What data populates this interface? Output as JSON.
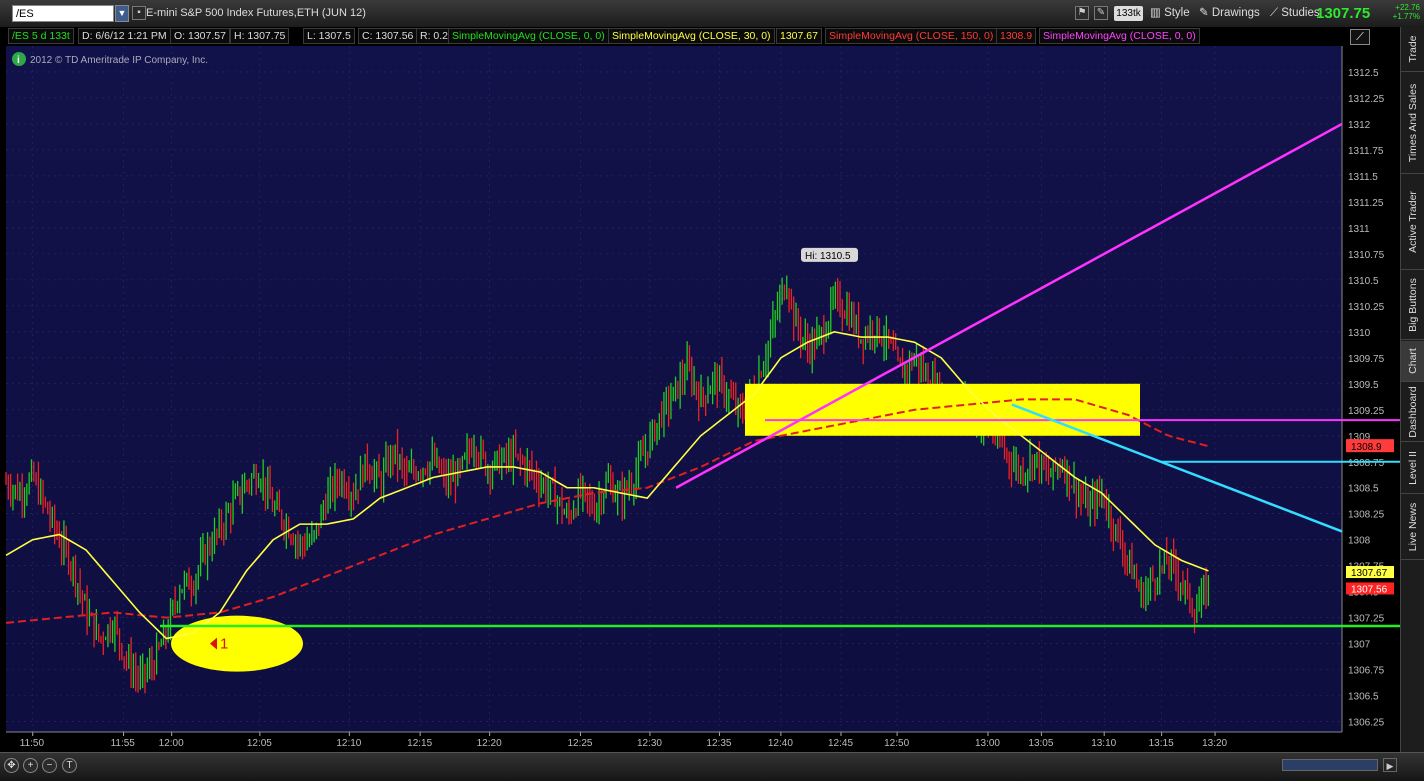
{
  "toolbar": {
    "symbol": "/ES",
    "instrument_name": "E-mini S&P 500 Index Futures,ETH (JUN 12)",
    "ticks_badge": "133tk",
    "style_label": "Style",
    "drawings_label": "Drawings",
    "studies_label": "Studies",
    "last_price": "1307.75",
    "net_change": "+22.76",
    "net_change_pct": "+1.77%"
  },
  "infobar": {
    "symbol_period": "/ES 5 d 133t",
    "date": "D: 6/6/12 1:21 PM",
    "open": "O: 1307.57",
    "high": "H: 1307.75",
    "low": "L: 1307.5",
    "close": "C: 1307.56",
    "range": "R: 0.25",
    "study1": "SimpleMovingAvg (CLOSE, 0, 0)",
    "study2": "SimpleMovingAvg (CLOSE, 30, 0)",
    "study2_value": "1307.67",
    "study3": "SimpleMovingAvg (CLOSE, 150, 0)",
    "study3_value": "1308.9",
    "study4": "SimpleMovingAvg (CLOSE, 0, 0)",
    "copyright": "2012 © TD Ameritrade IP Company, Inc.",
    "colors": {
      "green": "#22dd22",
      "yellow": "#ffff44",
      "red": "#ff3b3b",
      "magenta": "#ff44ff"
    }
  },
  "side_tabs": [
    "Trade",
    "Times And Sales",
    "Active Trader",
    "Big Buttons",
    "Chart",
    "Dashboard",
    "Level II",
    "Live News"
  ],
  "chart_data": {
    "type": "bar",
    "x_ticks": [
      "11:50",
      "11:55",
      "12:00",
      "12:05",
      "12:10",
      "12:15",
      "12:20",
      "12:25",
      "12:30",
      "12:35",
      "12:40",
      "12:45",
      "12:50",
      "13:00",
      "13:05",
      "13:10",
      "13:15",
      "13:20"
    ],
    "y_ticks": [
      "1312.5",
      "1312.25",
      "1312",
      "1311.75",
      "1311.5",
      "1311.25",
      "1311",
      "1310.75",
      "1310.5",
      "1310.25",
      "1310",
      "1309.75",
      "1309.5",
      "1309.25",
      "1309",
      "1308.75",
      "1308.5",
      "1308.25",
      "1308",
      "1307.75",
      "1307.5",
      "1307.25",
      "1307",
      "1306.75",
      "1306.5",
      "1306.25"
    ],
    "ylim": [
      1306.15,
      1312.75
    ],
    "hi_label": "Hi: 1310.5",
    "last_label": "1307.56",
    "sma30_label": "1307.67",
    "sma150_label": "1308.9",
    "annotation": "1",
    "price_path": [
      [
        0,
        1308.55
      ],
      [
        0.01,
        1308.45
      ],
      [
        0.02,
        1308.6
      ],
      [
        0.03,
        1308.3
      ],
      [
        0.04,
        1308.0
      ],
      [
        0.05,
        1307.75
      ],
      [
        0.06,
        1307.3
      ],
      [
        0.07,
        1307.05
      ],
      [
        0.08,
        1307.2
      ],
      [
        0.09,
        1306.85
      ],
      [
        0.1,
        1306.65
      ],
      [
        0.11,
        1306.8
      ],
      [
        0.115,
        1306.95
      ],
      [
        0.12,
        1307.1
      ],
      [
        0.13,
        1307.55
      ],
      [
        0.14,
        1307.6
      ],
      [
        0.15,
        1307.9
      ],
      [
        0.16,
        1308.1
      ],
      [
        0.17,
        1308.35
      ],
      [
        0.18,
        1308.55
      ],
      [
        0.19,
        1308.65
      ],
      [
        0.2,
        1308.3
      ],
      [
        0.21,
        1308.15
      ],
      [
        0.22,
        1307.95
      ],
      [
        0.23,
        1308.0
      ],
      [
        0.24,
        1308.4
      ],
      [
        0.25,
        1308.6
      ],
      [
        0.26,
        1308.45
      ],
      [
        0.27,
        1308.75
      ],
      [
        0.28,
        1308.55
      ],
      [
        0.29,
        1308.85
      ],
      [
        0.3,
        1308.6
      ],
      [
        0.31,
        1308.7
      ],
      [
        0.32,
        1308.75
      ],
      [
        0.33,
        1308.55
      ],
      [
        0.34,
        1308.65
      ],
      [
        0.35,
        1308.95
      ],
      [
        0.36,
        1308.7
      ],
      [
        0.37,
        1308.75
      ],
      [
        0.38,
        1308.8
      ],
      [
        0.39,
        1308.7
      ],
      [
        0.4,
        1308.55
      ],
      [
        0.41,
        1308.45
      ],
      [
        0.42,
        1308.2
      ],
      [
        0.43,
        1308.45
      ],
      [
        0.44,
        1308.3
      ],
      [
        0.45,
        1308.55
      ],
      [
        0.46,
        1308.4
      ],
      [
        0.47,
        1308.6
      ],
      [
        0.48,
        1308.9
      ],
      [
        0.49,
        1309.2
      ],
      [
        0.5,
        1309.4
      ],
      [
        0.51,
        1309.65
      ],
      [
        0.52,
        1309.35
      ],
      [
        0.53,
        1309.55
      ],
      [
        0.54,
        1309.4
      ],
      [
        0.55,
        1309.2
      ],
      [
        0.56,
        1309.45
      ],
      [
        0.57,
        1309.85
      ],
      [
        0.58,
        1310.35
      ],
      [
        0.585,
        1310.5
      ],
      [
        0.59,
        1310.1
      ],
      [
        0.6,
        1309.85
      ],
      [
        0.61,
        1309.95
      ],
      [
        0.62,
        1310.3
      ],
      [
        0.63,
        1310.2
      ],
      [
        0.64,
        1309.95
      ],
      [
        0.65,
        1310.05
      ],
      [
        0.66,
        1309.9
      ],
      [
        0.67,
        1309.6
      ],
      [
        0.68,
        1309.75
      ],
      [
        0.69,
        1309.55
      ],
      [
        0.7,
        1309.4
      ],
      [
        0.71,
        1309.2
      ],
      [
        0.72,
        1309.3
      ],
      [
        0.73,
        1309.1
      ],
      [
        0.74,
        1309.0
      ],
      [
        0.75,
        1308.8
      ],
      [
        0.76,
        1308.65
      ],
      [
        0.77,
        1308.8
      ],
      [
        0.78,
        1308.6
      ],
      [
        0.79,
        1308.75
      ],
      [
        0.8,
        1308.5
      ],
      [
        0.81,
        1308.3
      ],
      [
        0.82,
        1308.45
      ],
      [
        0.83,
        1308.1
      ],
      [
        0.84,
        1307.8
      ],
      [
        0.85,
        1307.45
      ],
      [
        0.86,
        1307.65
      ],
      [
        0.87,
        1307.8
      ],
      [
        0.88,
        1307.6
      ],
      [
        0.89,
        1307.3
      ],
      [
        0.9,
        1307.55
      ]
    ],
    "sma30_path": [
      [
        0,
        1307.85
      ],
      [
        0.02,
        1308.0
      ],
      [
        0.04,
        1308.05
      ],
      [
        0.06,
        1307.9
      ],
      [
        0.08,
        1307.6
      ],
      [
        0.1,
        1307.3
      ],
      [
        0.12,
        1307.05
      ],
      [
        0.14,
        1307.1
      ],
      [
        0.16,
        1307.3
      ],
      [
        0.18,
        1307.7
      ],
      [
        0.2,
        1308.0
      ],
      [
        0.22,
        1308.15
      ],
      [
        0.24,
        1308.15
      ],
      [
        0.26,
        1308.2
      ],
      [
        0.28,
        1308.4
      ],
      [
        0.3,
        1308.5
      ],
      [
        0.32,
        1308.6
      ],
      [
        0.34,
        1308.65
      ],
      [
        0.36,
        1308.7
      ],
      [
        0.38,
        1308.7
      ],
      [
        0.4,
        1308.65
      ],
      [
        0.42,
        1308.5
      ],
      [
        0.44,
        1308.5
      ],
      [
        0.46,
        1308.45
      ],
      [
        0.48,
        1308.4
      ],
      [
        0.5,
        1308.7
      ],
      [
        0.52,
        1309.0
      ],
      [
        0.54,
        1309.2
      ],
      [
        0.56,
        1309.4
      ],
      [
        0.58,
        1309.75
      ],
      [
        0.6,
        1309.9
      ],
      [
        0.62,
        1310.0
      ],
      [
        0.64,
        1309.95
      ],
      [
        0.66,
        1309.95
      ],
      [
        0.68,
        1309.9
      ],
      [
        0.7,
        1309.75
      ],
      [
        0.72,
        1309.45
      ],
      [
        0.74,
        1309.2
      ],
      [
        0.76,
        1309.0
      ],
      [
        0.78,
        1308.8
      ],
      [
        0.8,
        1308.6
      ],
      [
        0.82,
        1308.45
      ],
      [
        0.84,
        1308.2
      ],
      [
        0.86,
        1307.95
      ],
      [
        0.88,
        1307.8
      ],
      [
        0.9,
        1307.7
      ]
    ],
    "sma150_path": [
      [
        0,
        1307.2
      ],
      [
        0.04,
        1307.25
      ],
      [
        0.08,
        1307.3
      ],
      [
        0.12,
        1307.25
      ],
      [
        0.16,
        1307.3
      ],
      [
        0.2,
        1307.45
      ],
      [
        0.24,
        1307.65
      ],
      [
        0.28,
        1307.85
      ],
      [
        0.32,
        1308.05
      ],
      [
        0.36,
        1308.2
      ],
      [
        0.4,
        1308.35
      ],
      [
        0.44,
        1308.45
      ],
      [
        0.48,
        1308.5
      ],
      [
        0.52,
        1308.7
      ],
      [
        0.56,
        1308.95
      ],
      [
        0.6,
        1309.05
      ],
      [
        0.64,
        1309.15
      ],
      [
        0.68,
        1309.25
      ],
      [
        0.72,
        1309.3
      ],
      [
        0.76,
        1309.35
      ],
      [
        0.8,
        1309.35
      ],
      [
        0.84,
        1309.2
      ],
      [
        0.87,
        1309.0
      ],
      [
        0.9,
        1308.9
      ]
    ]
  }
}
